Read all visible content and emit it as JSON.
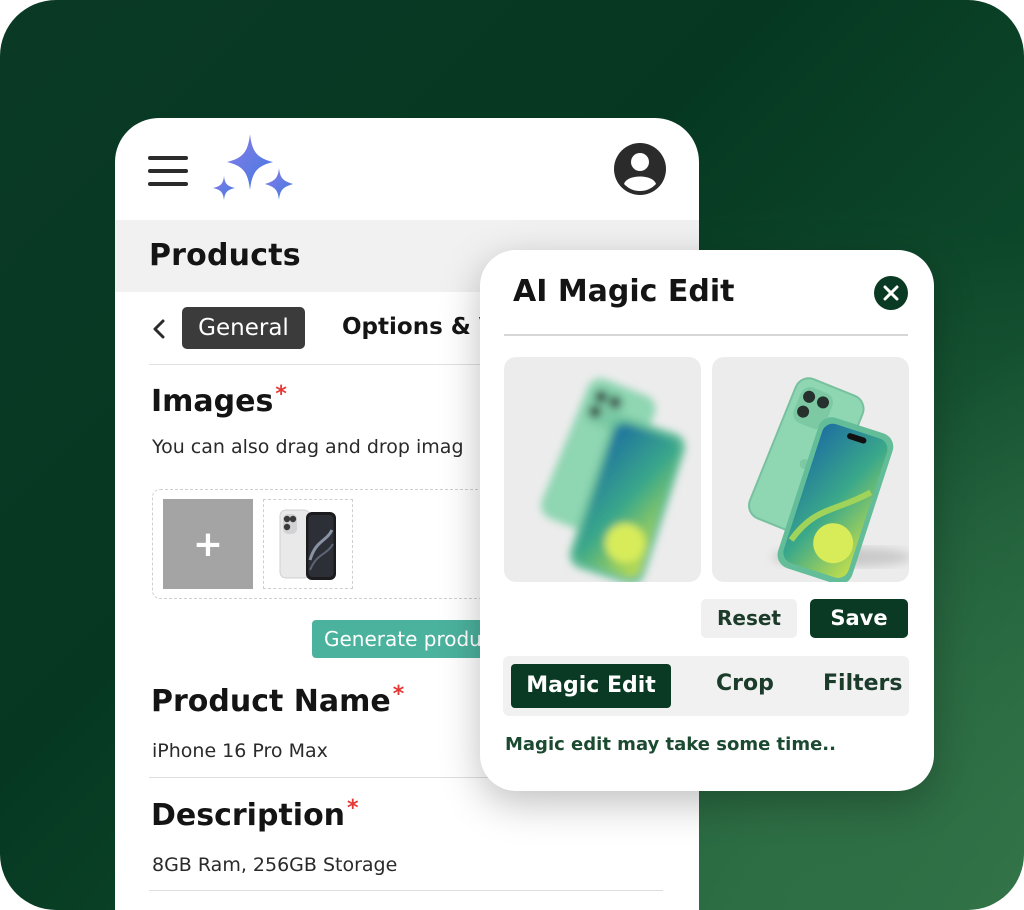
{
  "header": {
    "menu_icon": "hamburger-menu-icon",
    "logo_icon": "ai-sparkle-icon",
    "avatar_icon": "user-avatar-icon"
  },
  "page": {
    "title": "Products"
  },
  "tabs": {
    "back_icon": "chevron-left-icon",
    "items": [
      "General",
      "Options & V"
    ],
    "active": "General"
  },
  "images_section": {
    "title": "Images",
    "required_mark": "*",
    "helper": "You can also drag and drop imag",
    "add_label": "+",
    "generate_button": "Generate produ"
  },
  "product_name": {
    "label": "Product Name",
    "required_mark": "*",
    "value": "iPhone 16 Pro Max"
  },
  "description": {
    "label": "Description",
    "required_mark": "*",
    "value": "8GB Ram, 256GB Storage"
  },
  "modal": {
    "title": "AI Magic Edit",
    "close_icon": "close-icon",
    "actions": {
      "reset": "Reset",
      "save": "Save"
    },
    "segments": [
      "Magic Edit",
      "Crop",
      "Filters"
    ],
    "active_segment": "Magic Edit",
    "note": "Magic edit may take some time.."
  },
  "colors": {
    "brand_dark_green": "#0b3a24",
    "teal_button": "#4bb29e",
    "required_red": "#e53935",
    "tab_active": "#3b3b3b"
  }
}
